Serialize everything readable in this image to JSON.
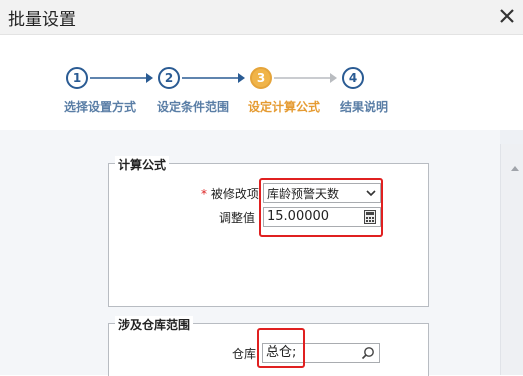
{
  "dialog": {
    "title": "批量设置"
  },
  "steps": [
    {
      "number": "1",
      "label": "选择设置方式",
      "state": "done"
    },
    {
      "number": "2",
      "label": "设定条件范围",
      "state": "done"
    },
    {
      "number": "3",
      "label": "设定计算公式",
      "state": "active"
    },
    {
      "number": "4",
      "label": "结果说明",
      "state": "todo"
    }
  ],
  "formula_group": {
    "legend": "计算公式",
    "modify_item": {
      "required_mark": "*",
      "label": "被修改项",
      "value": "库龄预警天数"
    },
    "adjust_value": {
      "label": "调整值",
      "value": "15.00000"
    }
  },
  "warehouse_group": {
    "legend": "涉及仓库范围",
    "warehouse": {
      "label": "仓库",
      "value": "总仓;"
    }
  },
  "colors": {
    "step_done": "#2a5b93",
    "step_active": "#f0b449",
    "highlight": "#e02020"
  },
  "icons": [
    "close-icon",
    "arrow-right-icon",
    "dropdown-icon",
    "calculator-icon",
    "search-icon",
    "scroll-up-icon"
  ]
}
